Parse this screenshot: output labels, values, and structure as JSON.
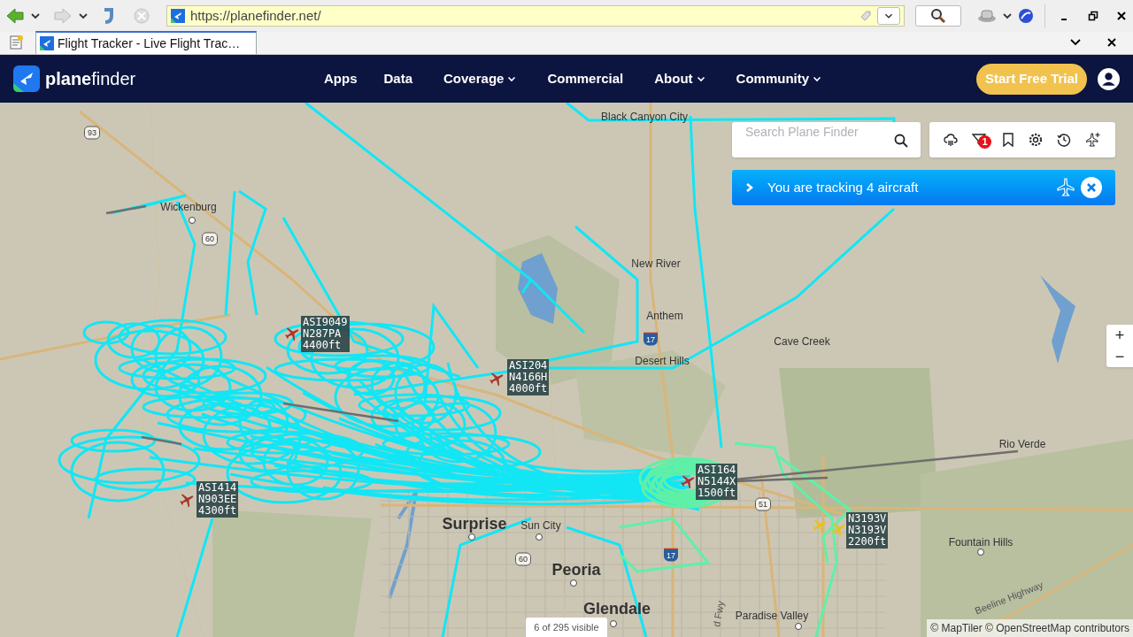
{
  "browser": {
    "url": "https://planefinder.net/",
    "tab_title": "Flight Tracker - Live Flight Trac…"
  },
  "nav": {
    "logo": "**plane**finder",
    "items": [
      {
        "label": "Apps",
        "dropdown": false
      },
      {
        "label": "Data",
        "dropdown": false
      },
      {
        "label": "Coverage",
        "dropdown": true
      },
      {
        "label": "Commercial",
        "dropdown": false
      },
      {
        "label": "About",
        "dropdown": true
      },
      {
        "label": "Community",
        "dropdown": true
      }
    ],
    "cta": "Start Free Trial"
  },
  "search": {
    "placeholder": "Search Plane Finder"
  },
  "map_tools": {
    "filter_badge": "1"
  },
  "tracking_banner": {
    "text": "You are tracking 4 aircraft"
  },
  "map": {
    "places": [
      {
        "name": "Black Canyon City",
        "kind": "town"
      },
      {
        "name": "93",
        "kind": "shield"
      },
      {
        "name": "Wickenburg",
        "kind": "town"
      },
      {
        "name": "60",
        "kind": "shield"
      },
      {
        "name": "New River",
        "kind": "town"
      },
      {
        "name": "Anthem",
        "kind": "town"
      },
      {
        "name": "17",
        "kind": "interstate"
      },
      {
        "name": "Desert Hills",
        "kind": "town"
      },
      {
        "name": "Cave Creek",
        "kind": "town"
      },
      {
        "name": "Rio Verde",
        "kind": "town"
      },
      {
        "name": "51",
        "kind": "shield"
      },
      {
        "name": "Surprise",
        "kind": "city"
      },
      {
        "name": "Sun City",
        "kind": "town"
      },
      {
        "name": "60",
        "kind": "shield"
      },
      {
        "name": "17",
        "kind": "interstate"
      },
      {
        "name": "Peoria",
        "kind": "city"
      },
      {
        "name": "Fountain Hills",
        "kind": "town"
      },
      {
        "name": "Glendale",
        "kind": "city"
      },
      {
        "name": "Paradise Valley",
        "kind": "town"
      },
      {
        "name": "Beeline Highway",
        "kind": "road"
      },
      {
        "name": "d Fwy",
        "kind": "road"
      }
    ],
    "aircraft": [
      {
        "lines": [
          "ASI9049",
          "N287PA",
          "4400ft"
        ],
        "color": "#a8352c"
      },
      {
        "lines": [
          "ASI204",
          "N4166H",
          "4000ft"
        ],
        "color": "#a8352c"
      },
      {
        "lines": [
          "ASI414",
          "N903EE",
          "4300ft"
        ],
        "color": "#a8352c"
      },
      {
        "lines": [
          "ASI164",
          "N5144X",
          "1500ft"
        ],
        "color": "#a8352c"
      },
      {
        "lines": [
          "N3193V",
          "N3193V",
          "2200ft"
        ],
        "color": "#e6c21c"
      }
    ]
  },
  "zoom": {
    "in": "+",
    "out": "−"
  },
  "status": "6 of 295 visible",
  "attribution": "© MapTiler © OpenStreetMap contributors"
}
